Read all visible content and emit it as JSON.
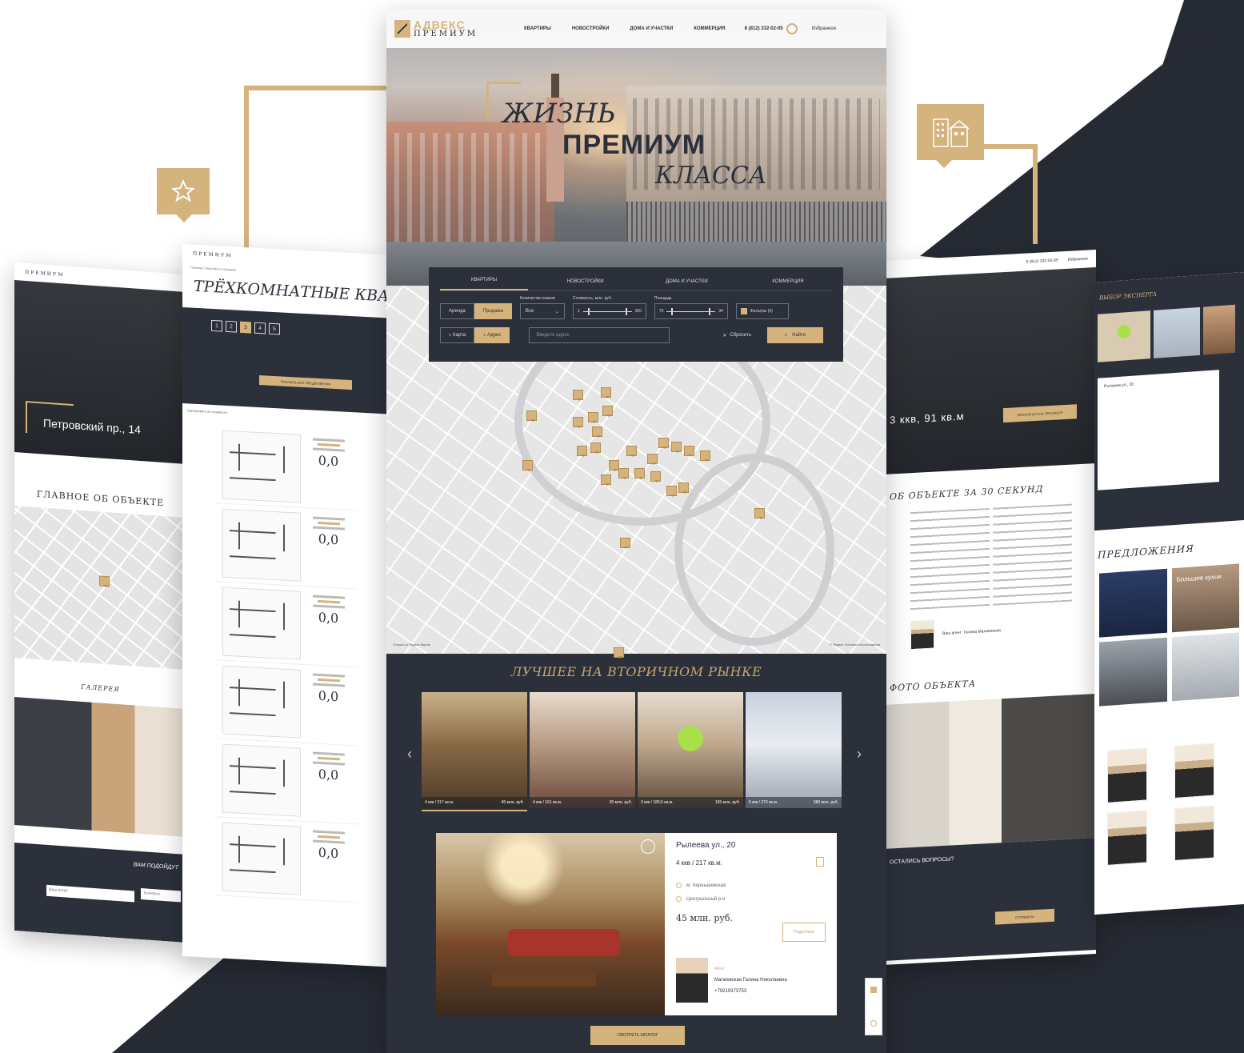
{
  "colors": {
    "accent": "#d4b47c",
    "navy": "#2b303b",
    "background": "#ffffff"
  },
  "badges": {
    "left_icon": "star-icon",
    "right_icon": "buildings-icon"
  },
  "center": {
    "logo": {
      "line1": "АДВЕКС",
      "line2": "ПРЕМИУМ"
    },
    "nav": [
      "КВАРТИРЫ",
      "НОВОСТРОЙКИ",
      "ДОМА И УЧАСТКИ",
      "КОММЕРЦИЯ"
    ],
    "phone": "8 (812) 332-02-05",
    "favorites": "Избранное",
    "slogan": {
      "line1": "ЖИЗНЬ",
      "line2": "ПРЕМИУМ",
      "line3": "КЛАССА"
    },
    "search": {
      "tabs": [
        "КВАРТИРЫ",
        "НОВОСТРОЙКИ",
        "ДОМА И УЧАСТКИ",
        "КОММЕРЦИЯ"
      ],
      "deal_rent": "Аренда",
      "deal_sale": "Продажа",
      "rooms_label": "Количество комнат",
      "rooms_value": "Все",
      "price_label": "Стоимость, млн. руб.",
      "price_from": "1",
      "price_to": "300",
      "area_label": "Площадь",
      "area_from": "70",
      "area_to": "34",
      "filters": "Фильтры (0)",
      "view_map": "Карта",
      "view_address": "Адрес",
      "address_placeholder": "Введите адрес",
      "reset": "Сбросить",
      "find": "Найти"
    },
    "map_credit_left": "Открыть в Яндекс.Картах",
    "map_credit_right": "© Яндекс Условия использования",
    "best_title": "ЛУЧШЕЕ НА ВТОРИЧНОМ РЫНКЕ",
    "slides": [
      {
        "size": "4 ккв / 217 кв.м.",
        "price": "45 млн. руб."
      },
      {
        "size": "4 ккв / 161 кв.м.",
        "price": "35 млн. руб."
      },
      {
        "size": "3 ккв / 180,5 кв.м.",
        "price": "165 млн. руб."
      },
      {
        "size": "5 ккв / 270 кв.м.",
        "price": "380 млн. руб."
      }
    ],
    "card": {
      "address": "Рылеева ул., 20",
      "size": "4 ккв / 217 кв.м.",
      "metro": "м. Чернышевская",
      "district": "Центральный р-н",
      "price": "45 млн. руб.",
      "more": "Подробнее",
      "agent_role": "Агент",
      "agent_name": "Малиевская Галина Николаевна",
      "agent_phone": "+79219373753"
    },
    "catalog_button": "СМОТРЕТЬ КАТАЛОГ"
  },
  "left1": {
    "hero_address": "Петровский пр., 14",
    "about_title": "ГЛАВНОЕ ОБ ОБЪЕКТЕ",
    "gallery_title": "ГАЛЕРЕЯ",
    "bottom_title": "ВАМ ПОДОЙДУТ",
    "email_placeholder": "Ваш email",
    "phone_placeholder": "Телефон"
  },
  "left2": {
    "breadcrumb": "Главная / Квартиры в продаже",
    "title": "ТРЁХКОМНАТНЫЕ КВАРТИРЫ",
    "rooms": [
      "1",
      "2",
      "3",
      "4",
      "5"
    ],
    "btn_apply": "ПОКАЗАТЬ ВСЕ ПРЕДЛОЖЕНИЯ",
    "sort": "Сортировать по стоимости",
    "prices": [
      "0,0",
      "0,0",
      "0,0",
      "0,0",
      "0,0",
      "0,0"
    ]
  },
  "right1": {
    "hero_text": "3 ккв, 91 кв.м",
    "hero_btn": "ЗАПИСАТЬСЯ НА ПРОСМОТР",
    "about_title": "ОБ ОБЪЕКТЕ ЗА 30 СЕКУНД",
    "photos_title": "ФОТО ОБЪЕКТА",
    "agent_text": "Ваш агент: Галина Малиевская",
    "form_title": "ОСТАЛИСЬ ВОПРОСЫ?",
    "form_btn": "ОТПРАВИТЬ"
  },
  "right2": {
    "top_title": "ВЫБОР ЭКСПЕРТА",
    "card_title": "Рылеева ул., 20",
    "offers_title": "ПРЕДЛОЖЕНИЯ",
    "tile_text": "Большие кухни"
  }
}
